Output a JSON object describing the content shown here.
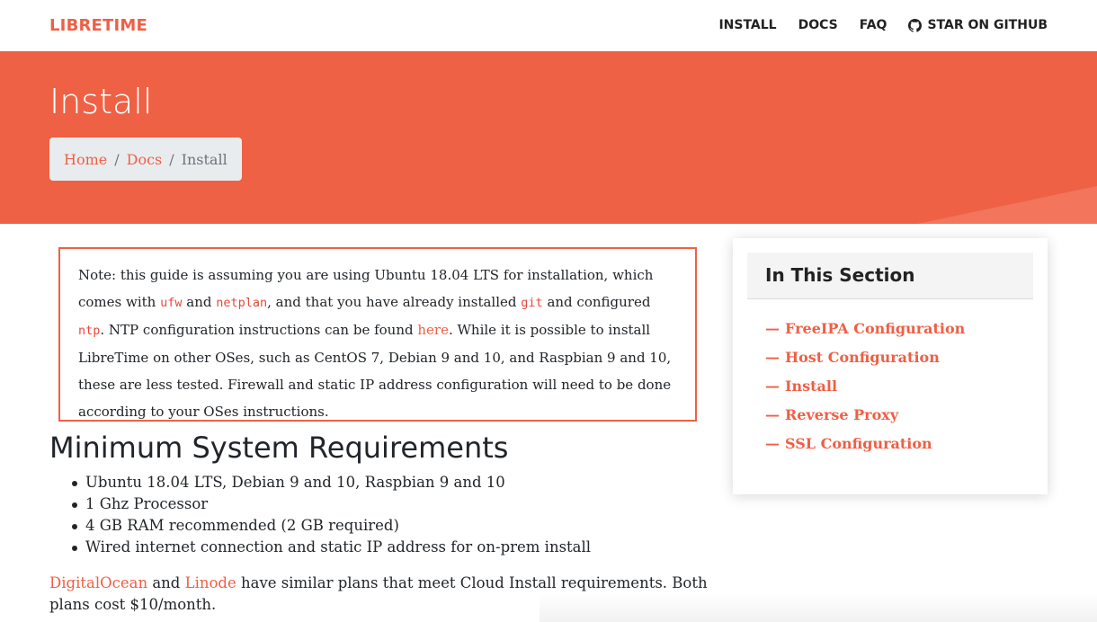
{
  "navbar": {
    "brand": "LIBRETIME",
    "links": [
      "INSTALL",
      "DOCS",
      "FAQ"
    ],
    "github_label": "STAR ON GITHUB"
  },
  "hero": {
    "title": "Install",
    "breadcrumb": [
      "Home",
      "Docs",
      "Install"
    ],
    "separator": "/"
  },
  "note": {
    "t1": "Note: this guide is assuming you are using Ubuntu 18.04 LTS for installation, which comes with ",
    "code1": "ufw",
    "t2": " and ",
    "code2": "netplan",
    "t3": ", and that you have already installed ",
    "code3": "git",
    "t4": " and configured ",
    "code4": "ntp",
    "t5": ". NTP configuration instructions can be found ",
    "link": "here",
    "t6": ". While it is possible to install LibreTime on other OSes, such as CentOS 7, Debian 9 and 10, and Raspbian 9 and 10, these are less tested. Firewall and static IP address configuration will need to be done according to your OSes instructions."
  },
  "content": {
    "heading": "Minimum System Requirements",
    "requirements": [
      "Ubuntu 18.04 LTS, Debian 9 and 10, Raspbian 9 and 10",
      "1 Ghz Processor",
      "4 GB RAM recommended (2 GB required)",
      "Wired internet connection and static IP address for on-prem install"
    ],
    "para_link1": "DigitalOcean",
    "para_t1": " and ",
    "para_link2": "Linode",
    "para_t2": " have similar plans that meet Cloud Install requirements. Both plans cost $10/month."
  },
  "sidebar": {
    "title": "In This Section",
    "dash": "—",
    "items": [
      "FreeIPA Configuration",
      "Host Configuration",
      "Install",
      "Reverse Proxy",
      "SSL Configuration"
    ]
  },
  "colors": {
    "accent": "#ef6144",
    "text": "#212529",
    "breadcrumb_bg": "#e9ecef"
  }
}
